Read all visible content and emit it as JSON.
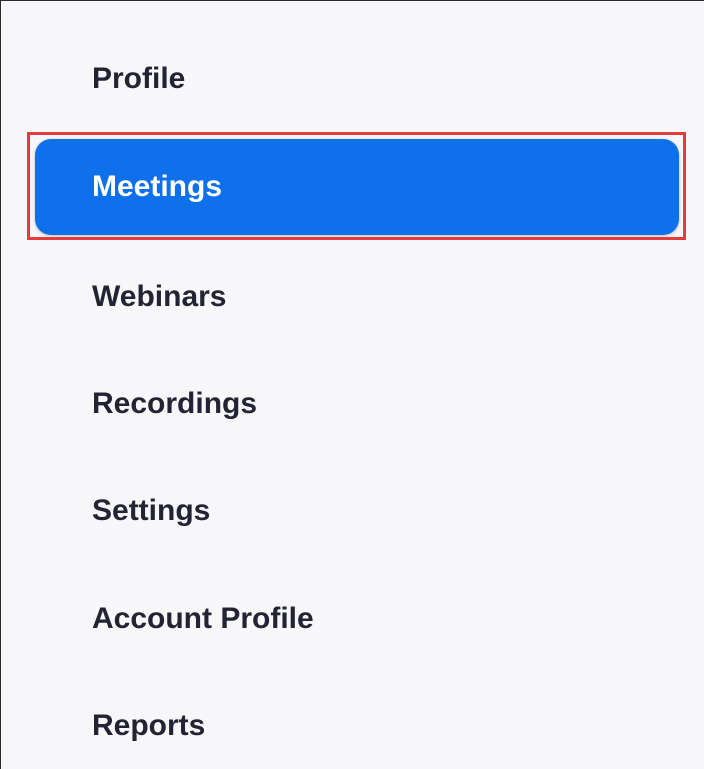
{
  "sidebar": {
    "items": [
      {
        "label": "Profile",
        "active": false
      },
      {
        "label": "Meetings",
        "active": true
      },
      {
        "label": "Webinars",
        "active": false
      },
      {
        "label": "Recordings",
        "active": false
      },
      {
        "label": "Settings",
        "active": false
      },
      {
        "label": "Account Profile",
        "active": false
      },
      {
        "label": "Reports",
        "active": false
      }
    ]
  },
  "colors": {
    "background": "#f7f7fa",
    "active_item": "#0e71eb",
    "text": "#232333",
    "highlight": "#e63b3b"
  }
}
